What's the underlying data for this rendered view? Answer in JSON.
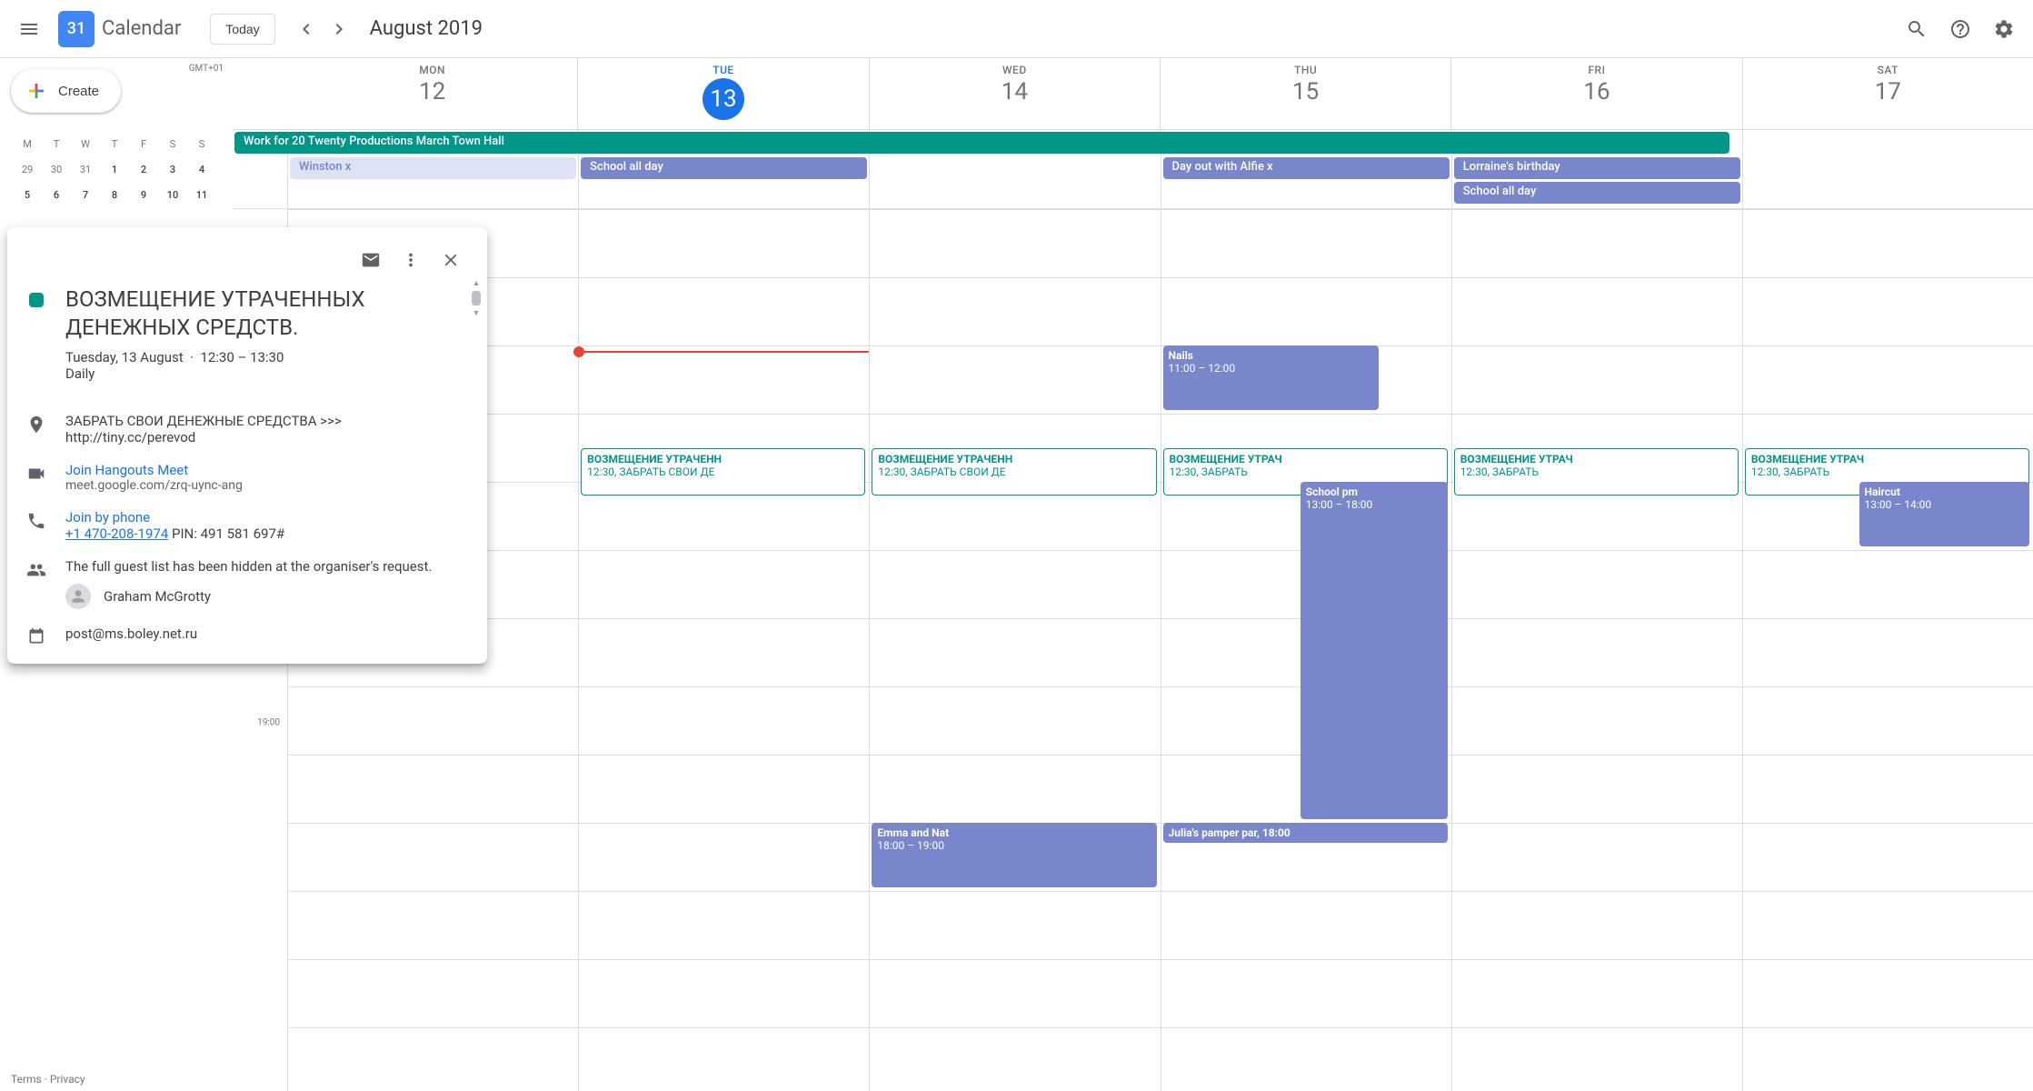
{
  "header": {
    "logo_day": "31",
    "app_title": "Calendar",
    "today_label": "Today",
    "month_label": "August 2019"
  },
  "sidebar": {
    "create_label": "Create",
    "timezone": "GMT+01",
    "mini_headers": [
      "M",
      "T",
      "W",
      "T",
      "F",
      "S",
      "S"
    ],
    "mini_rows": [
      [
        "29",
        "30",
        "31",
        "1",
        "2",
        "3",
        "4"
      ],
      [
        "5",
        "6",
        "7",
        "8",
        "9",
        "10",
        "11"
      ]
    ],
    "footer": "Terms · Privacy"
  },
  "days": [
    {
      "name": "MON",
      "num": "12",
      "today": false
    },
    {
      "name": "TUE",
      "num": "13",
      "today": true
    },
    {
      "name": "WED",
      "num": "14",
      "today": false
    },
    {
      "name": "THU",
      "num": "15",
      "today": false
    },
    {
      "name": "FRI",
      "num": "16",
      "today": false
    },
    {
      "name": "SAT",
      "num": "17",
      "today": false
    }
  ],
  "allday": {
    "spanner": "Work for 20 Twenty Productions March Town Hall",
    "mon": [
      "Winston x"
    ],
    "tue": [
      "School all day"
    ],
    "thu": [
      "Day out with Alfie x"
    ],
    "fri": [
      "Lorraine's birthday",
      "School all day"
    ]
  },
  "spam": {
    "title": "ВОЗМЕЩЕНИЕ УТРАЧЕНН",
    "sub": "12:30, ЗАБРАТЬ СВОИ ДЕ",
    "title_short": "ВОЗМЕЩЕНИЕ УТРАЧ",
    "sub_short": "12:30, ЗАБРАТЬ"
  },
  "events": {
    "nails": {
      "title": "Nails",
      "time": "11:00 – 12:00"
    },
    "school_pm": {
      "title": "School pm",
      "time": "13:00 – 18:00"
    },
    "emma": {
      "title": "Emma and Nat",
      "time": "18:00 – 19:00"
    },
    "julia": {
      "title": "Julia's pamper par",
      "time": "18:00"
    },
    "haircut": {
      "title": "Haircut",
      "time": "13:00 – 14:00"
    }
  },
  "time_labels": [
    "19:00"
  ],
  "popup": {
    "title": "ВОЗМЕЩЕНИЕ УТРАЧЕННЫХ ДЕНЕЖНЫХ СРЕДСТВ.",
    "date": "Tuesday, 13 August",
    "time": "12:30 – 13:30",
    "recurrence": "Daily",
    "location": "ЗАБРАТЬ СВОИ ДЕНЕЖНЫЕ СРЕДСТВА >>> http://tiny.cc/perevod",
    "meet_label": "Join Hangouts Meet",
    "meet_url": "meet.google.com/zrq-uync-ang",
    "phone_label": "Join by phone",
    "phone_number": "+1 470-208-1974",
    "phone_pin": "PIN: 491 581 697#",
    "guest_note": "The full guest list has been hidden at the organiser's request.",
    "guest_name": "Graham McGrotty",
    "organizer_email": "post@ms.boley.net.ru"
  }
}
